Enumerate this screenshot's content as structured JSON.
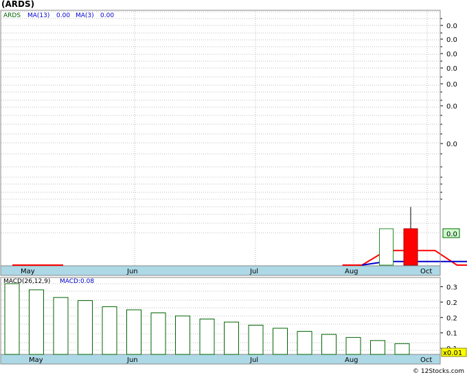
{
  "title": "(ARDS)",
  "footer": "© 12Stocks.com",
  "chart_data": [
    {
      "type": "candlestick",
      "name": "price-panel",
      "legend": [
        {
          "text": "ARDS",
          "color": "#006400"
        },
        {
          "text": "MA(13)",
          "color": "#0000cc"
        },
        {
          "text": "0.00",
          "color": "#0000cc"
        },
        {
          "text": "MA(3)",
          "color": "#0000cc"
        },
        {
          "text": "0.00",
          "color": "#0000cc"
        }
      ],
      "y_tick_labels": [
        "0.0",
        "0.0",
        "0.0",
        "0.0",
        "0.0",
        "0.0",
        "0.0"
      ],
      "last_price_label": "0.0",
      "x_tick_labels": [
        "May",
        "Jun",
        "Jul",
        "Aug",
        "Oct"
      ],
      "grid": true,
      "colors": {
        "up": "#228b22",
        "down": "#ff0000",
        "ma13": "#0000cc",
        "ma3": "#ff0000",
        "axis_band": "#add8e6"
      },
      "candles": [
        {
          "week": 16,
          "direction": "up",
          "open": 0.0,
          "close": 0.1,
          "high": 0.1,
          "low": 0.0
        },
        {
          "week": 17,
          "direction": "down",
          "open": 0.1,
          "close": 0.0,
          "high": 0.16,
          "low": 0.0
        },
        {
          "week": 27,
          "direction": "flat",
          "open": 0.0,
          "close": 0.0,
          "high": 0.1,
          "low": 0.0
        },
        {
          "week": 28,
          "direction": "flat",
          "open": 0.0,
          "close": 0.0,
          "high": 0.66,
          "low": 0.0
        },
        {
          "week": 30,
          "direction": "down",
          "open": 0.1,
          "close": 0.0,
          "high": 0.1,
          "low": 0.0
        },
        {
          "week": 31,
          "direction": "flat",
          "open": 0.1,
          "close": 0.1,
          "high": 0.1,
          "low": 0.1
        }
      ],
      "ma13": [
        {
          "week": 15,
          "value": 0.0
        },
        {
          "week": 16,
          "value": 0.01
        },
        {
          "week": 17,
          "value": 0.01
        },
        {
          "week": 29,
          "value": 0.01
        },
        {
          "week": 30,
          "value": 0.0
        },
        {
          "week": 31,
          "value": 0.01
        }
      ],
      "ma3": [
        {
          "week": 14.2,
          "value": 0.0
        },
        {
          "week": 15,
          "value": 0.0
        },
        {
          "week": 16,
          "value": 0.04
        },
        {
          "week": 18,
          "value": 0.04
        },
        {
          "week": 18.9,
          "value": 0.0
        },
        {
          "week": 29.8,
          "value": 0.0
        },
        {
          "week": 30.5,
          "value": 0.0
        },
        {
          "week": 31,
          "value": 0.04
        }
      ]
    },
    {
      "type": "bar",
      "name": "macd-panel",
      "legend": [
        {
          "text": "MACD(26,12,9)",
          "color": "#000000"
        },
        {
          "text": "MACD:0.08",
          "color": "#0000cc"
        }
      ],
      "y_tick_labels": [
        "0.3",
        "0.2",
        "0.2",
        "0.1",
        "0.1"
      ],
      "y_ticks": [
        0.3,
        0.25,
        0.2,
        0.15,
        0.1
      ],
      "scale_label": "x0.01",
      "x_tick_labels": [
        "May",
        "Jun",
        "Jul",
        "Aug",
        "Oct"
      ],
      "ylim": [
        0.08,
        0.31
      ],
      "values": [
        0.31,
        0.29,
        0.265,
        0.255,
        0.235,
        0.225,
        0.215,
        0.205,
        0.195,
        0.185,
        0.175,
        0.165,
        0.155,
        0.145,
        0.135,
        0.125,
        0.115
      ],
      "bar_color": "#006400"
    }
  ]
}
